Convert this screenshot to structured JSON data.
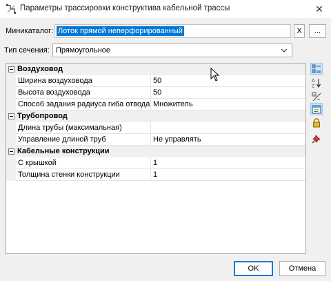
{
  "window": {
    "title": "Параметры трассировки конструктива кабельной трассы",
    "close_glyph": "✕"
  },
  "minicatalog": {
    "label": "Миникаталог:",
    "value": "Лоток прямой неперфорированный",
    "clear_label": "X",
    "browse_label": "..."
  },
  "section_type": {
    "label": "Тип сечения:",
    "selected": "Прямоугольное"
  },
  "property_grid": {
    "categories": [
      {
        "label": "Воздуховод",
        "rows": [
          {
            "name": "Ширина воздуховода",
            "value": "50"
          },
          {
            "name": "Высота воздуховода",
            "value": "50"
          },
          {
            "name": "Способ задания радиуса гиба отвода",
            "value": "Множитель"
          }
        ]
      },
      {
        "label": "Трубопровод",
        "rows": [
          {
            "name": "Длина трубы (максимальная)",
            "value": ""
          },
          {
            "name": "Управление длиной труб",
            "value": "Не управлять"
          }
        ]
      },
      {
        "label": "Кабельные конструкции",
        "rows": [
          {
            "name": "С крышкой",
            "value": "1"
          },
          {
            "name": "Толщина стенки конструкции",
            "value": "1"
          }
        ]
      }
    ]
  },
  "toolbar_icons": [
    "categorized-icon",
    "sort-alpha-icon",
    "compare-icon",
    "property-pages-icon",
    "lock-icon",
    "pin-icon"
  ],
  "footer": {
    "ok_label": "OK",
    "cancel_label": "Отмена"
  },
  "colors": {
    "selection": "#0078d7",
    "category_bg": "#f0f0f0"
  }
}
